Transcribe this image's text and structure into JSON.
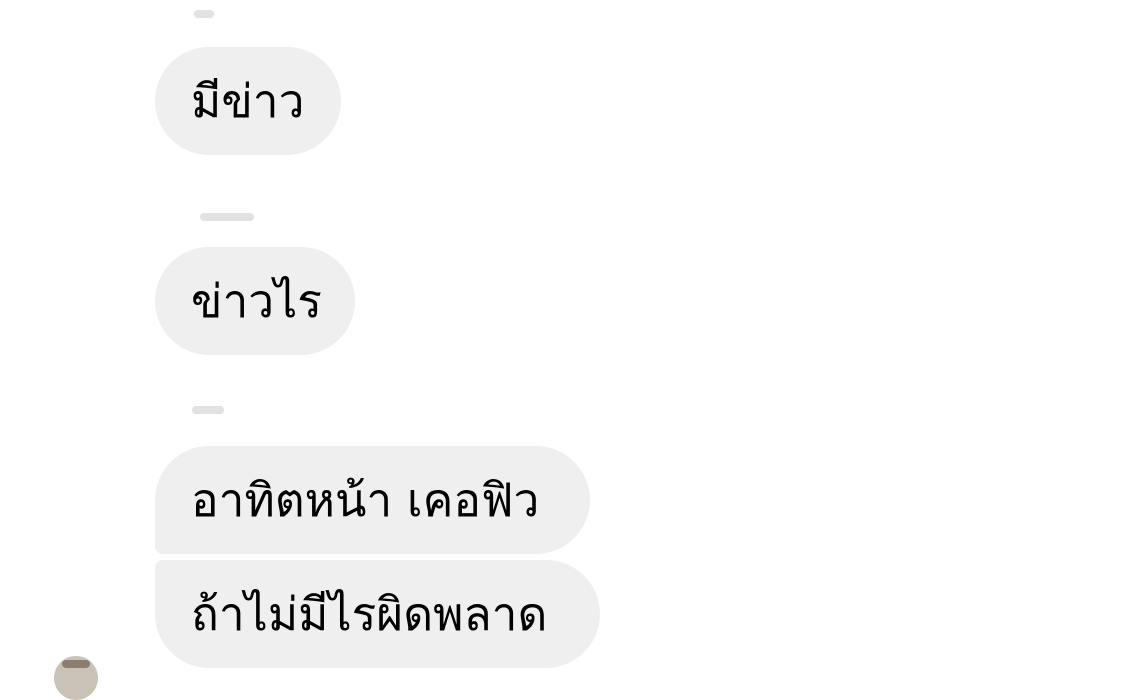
{
  "messages": [
    {
      "text": "มีข่าว"
    },
    {
      "text": "ข่าวไร"
    },
    {
      "text": "อาทิตหน้า เคอฟิว"
    },
    {
      "text": "ถ้าไม่มีไรผิดพลาด"
    }
  ],
  "colors": {
    "bubble_background": "#efefef",
    "text": "#000000",
    "page_background": "#ffffff"
  }
}
